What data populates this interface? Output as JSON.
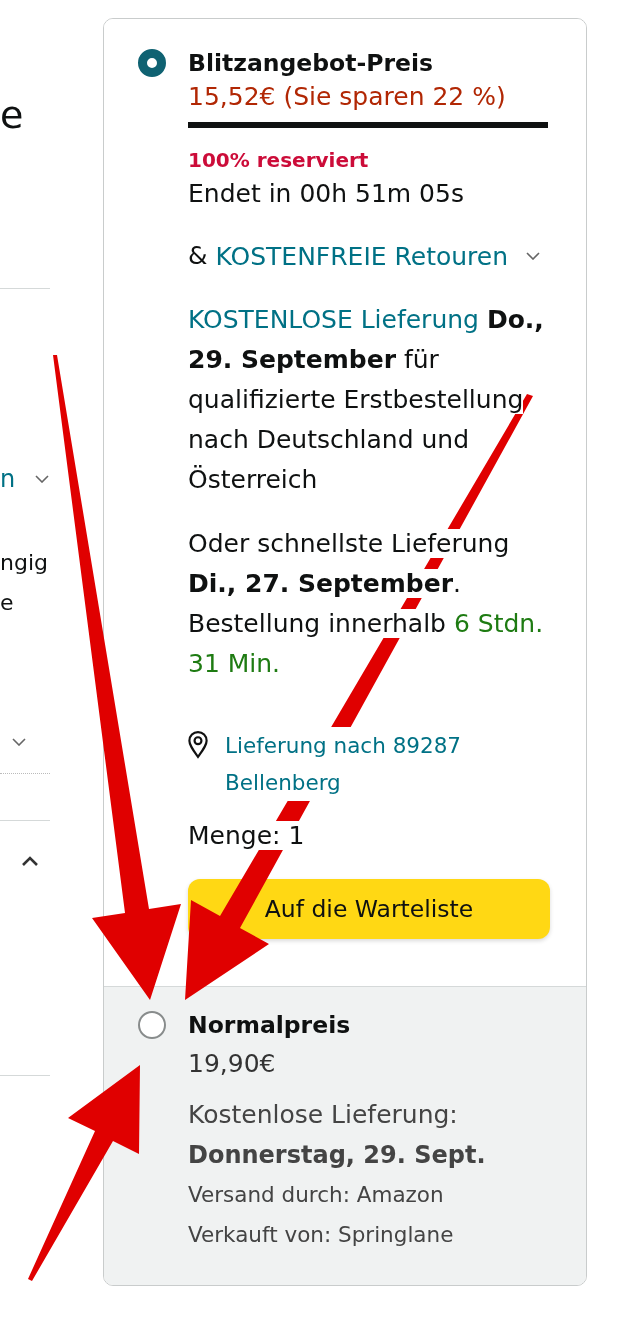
{
  "left_column": {
    "heading": "e",
    "link": "n",
    "text_lines": [
      "ngig",
      "e"
    ],
    "section": {
      "expanded": true
    }
  },
  "deal_option": {
    "selected": true,
    "title": "Blitzangebot-Preis",
    "price": "15,52€ (Sie sparen 22 %)",
    "level": 1,
    "claimed": "100% reserviert",
    "countdown": "Endet in 00h 51m 05s",
    "returns_prefix": "&",
    "returns_link": "KOSTENFREIE Retouren",
    "delivery_link": "KOSTENLOSE Lieferung",
    "delivery_text": "**Do., 29. September** für qualifizierte Erstbestellung nach Deutschland und Österreich",
    "fastest_text": "Oder schnellste Lieferung **Di., 27. September**. Bestellung innerhalb",
    "fastest_time": "6 Stdn. 31 Min.",
    "location": "Lieferung nach 89287 Bellenberg",
    "quantity": "Menge: 1",
    "button": "Auf die Warteliste"
  },
  "standard_option": {
    "selected": false,
    "title": "Normalpreis",
    "price": "19,90€",
    "delivery_label": "Kostenlose Lieferung:",
    "delivery_date": "Donnerstag, 29. Sept.",
    "shipped_by": "Versand durch: Amazon",
    "sold_by": "Verkauft von: Springlane"
  }
}
